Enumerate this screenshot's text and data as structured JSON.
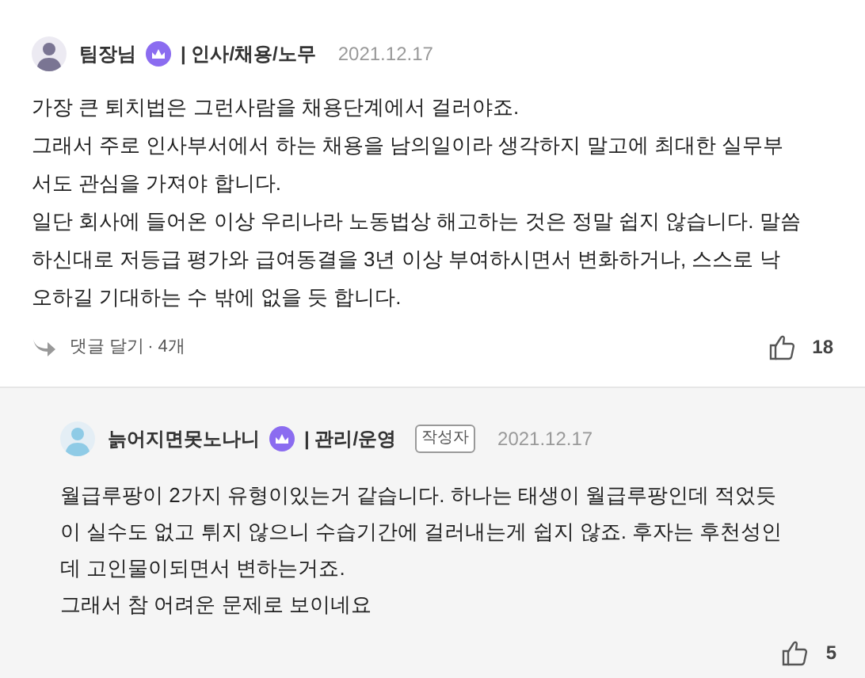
{
  "comments": [
    {
      "author": "팀장님",
      "department": "| 인사/채용/노무",
      "date": "2021.12.17",
      "kind": "comment",
      "lines": [
        "가장 큰 퇴치법은 그런사람을 채용단계에서 걸러야죠.",
        "그래서 주로 인사부서에서 하는 채용을 남의일이라 생각하지 말고에 최대한 실무부",
        "서도 관심을 가져야 합니다.",
        "일단 회사에 들어온 이상 우리나라 노동법상 해고하는 것은 정말 쉽지 않습니다. 말씀",
        "하신대로 저등급 평가와 급여동결을 3년 이상 부여하시면서 변화하거나, 스스로 낙",
        "오하길 기대하는 수 밖에 없을 듯 합니다."
      ],
      "reply_link": "댓글 달기",
      "reply_count": "· 4개",
      "likes": "18"
    },
    {
      "author": "늙어지면못노나니",
      "department": "| 관리/운영",
      "author_badge": "작성자",
      "date": "2021.12.17",
      "kind": "reply",
      "lines": [
        "월급루팡이 2가지 유형이있는거 같습니다. 하나는 태생이 월급루팡인데 적었듯",
        "이 실수도 없고 튀지 않으니 수습기간에 걸러내는게 쉽지 않죠. 후자는 후천성인",
        "데 고인물이되면서 변하는거죠.",
        "그래서 참 어려운 문제로 보이네요"
      ],
      "likes": "5"
    }
  ]
}
